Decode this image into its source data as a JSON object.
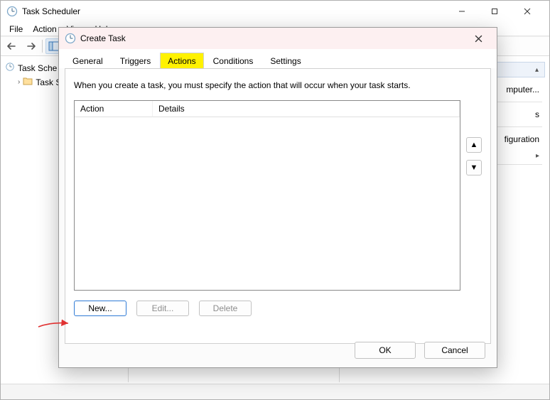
{
  "main_window": {
    "title": "Task Scheduler",
    "menu": {
      "file": "File",
      "action": "Action",
      "view": "View",
      "help": "Help"
    },
    "win_ctrls": {
      "min": "—",
      "max": "▢",
      "close": "✕"
    }
  },
  "tree": {
    "root": "Task Scheduler",
    "child": "Task Scheduler Library",
    "root_short": "Task Sche",
    "child_short": "Task S"
  },
  "right_pane": {
    "link_computer": "mputer...",
    "link_s": "s",
    "link_figuration": "figuration"
  },
  "dialog": {
    "title": "Create Task",
    "tabs": {
      "general": "General",
      "triggers": "Triggers",
      "actions": "Actions",
      "conditions": "Conditions",
      "settings": "Settings"
    },
    "panel": {
      "description": "When you create a task, you must specify the action that will occur when your task starts.",
      "col_action": "Action",
      "col_details": "Details",
      "btn_new": "New...",
      "btn_edit": "Edit...",
      "btn_delete": "Delete",
      "btn_up": "▲",
      "btn_down": "▼"
    },
    "footer": {
      "ok": "OK",
      "cancel": "Cancel"
    },
    "close": "✕"
  }
}
